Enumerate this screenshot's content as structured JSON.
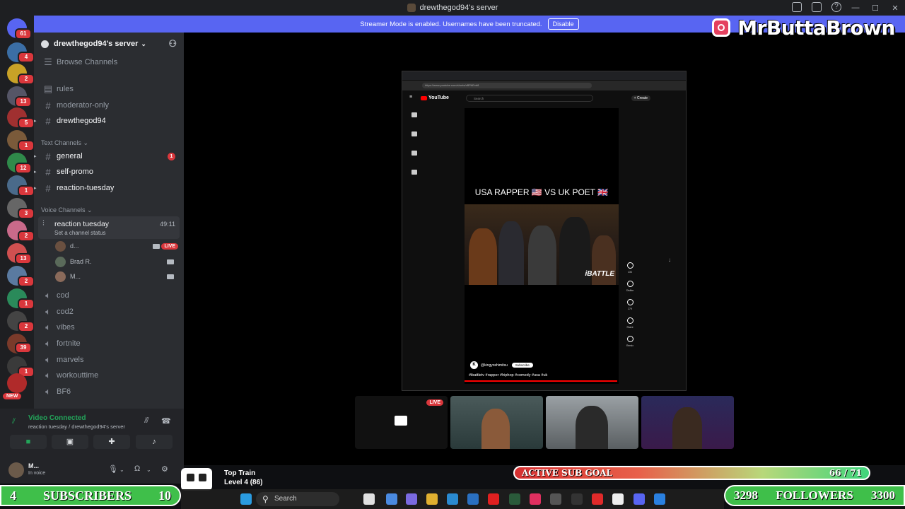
{
  "window": {
    "title": "drewthegod94's server"
  },
  "banner": {
    "text": "Streamer Mode is enabled. Usernames have been truncated.",
    "button": "Disable"
  },
  "brand": {
    "name": "MrButtaBrown"
  },
  "rail": {
    "badges": [
      "61",
      "4",
      "2",
      "13",
      "5",
      "1",
      "12",
      "1",
      "3",
      "2",
      "1",
      "13",
      "2",
      "1",
      "2",
      "39",
      "1",
      "1",
      "2"
    ],
    "new_label": "NEW"
  },
  "sidebar": {
    "server_name": "drewthegod94's server",
    "browse": "Browse Channels",
    "pinned": [
      {
        "name": "rules"
      },
      {
        "name": "moderator-only"
      },
      {
        "name": "drewthegod94"
      }
    ],
    "text_category": "Text Channels",
    "text_channels": [
      {
        "name": "general",
        "mentions": "1"
      },
      {
        "name": "self-promo"
      },
      {
        "name": "reaction-tuesday"
      }
    ],
    "voice_category": "Voice Channels",
    "active_voice": {
      "name": "reaction tuesday",
      "status": "Set a channel status",
      "time": "49:11"
    },
    "voice_users": [
      {
        "name": "d...",
        "live": "LIVE"
      },
      {
        "name": "Brad R."
      },
      {
        "name": "M..."
      }
    ],
    "voice_channels": [
      "cod",
      "cod2",
      "vibes",
      "fortnite",
      "marvels",
      "workouttime",
      "BF6"
    ]
  },
  "voice_panel": {
    "title": "Video Connected",
    "subtitle": "reaction tuesday / drewthegod94's server"
  },
  "user_panel": {
    "name": "M...",
    "status": "In voice"
  },
  "stream": {
    "url": "https://www.youtube.com/shorts/xBPAEvb8",
    "yt_logo": "YouTube",
    "search_placeholder": "Search",
    "create_label": "+ Create",
    "short_title": "USA RAPPER 🇺🇸 VS UK POET 🇬🇧",
    "watermark": "iBATTLE",
    "channel_handle": "@kingyoshimitsu",
    "subscribe": "Subscribe",
    "hashtags": "#ibattletv #rapper #hiphop #comedy #usa #uk",
    "actions": [
      {
        "icon": "like-icon",
        "label": "13K"
      },
      {
        "icon": "dislike-icon",
        "label": "Dislike"
      },
      {
        "icon": "comment-icon",
        "label": "279"
      },
      {
        "icon": "share-icon",
        "label": "Share"
      },
      {
        "icon": "remix-icon",
        "label": "Remix"
      }
    ]
  },
  "tiles": {
    "live_label": "LIVE"
  },
  "overlay": {
    "sub_goal_label": "ACTIVE SUB GOAL",
    "sub_goal_count": "66 / 71",
    "sub_goal_progress": 0.93,
    "subs_left": "4",
    "subs_label": "SUBSCRIBERS",
    "subs_right": "10",
    "followers_left": "3298",
    "followers_label": "FOLLOWERS",
    "followers_right": "3300",
    "train_title": "Top Train",
    "train_level": "Level 4 (86)"
  },
  "taskbar": {
    "search": "Search"
  },
  "colors": {
    "blurple": "#5865f2",
    "discord_bg": "#2b2d31",
    "live_red": "#da373c",
    "goal_green": "#3fbf4a"
  }
}
